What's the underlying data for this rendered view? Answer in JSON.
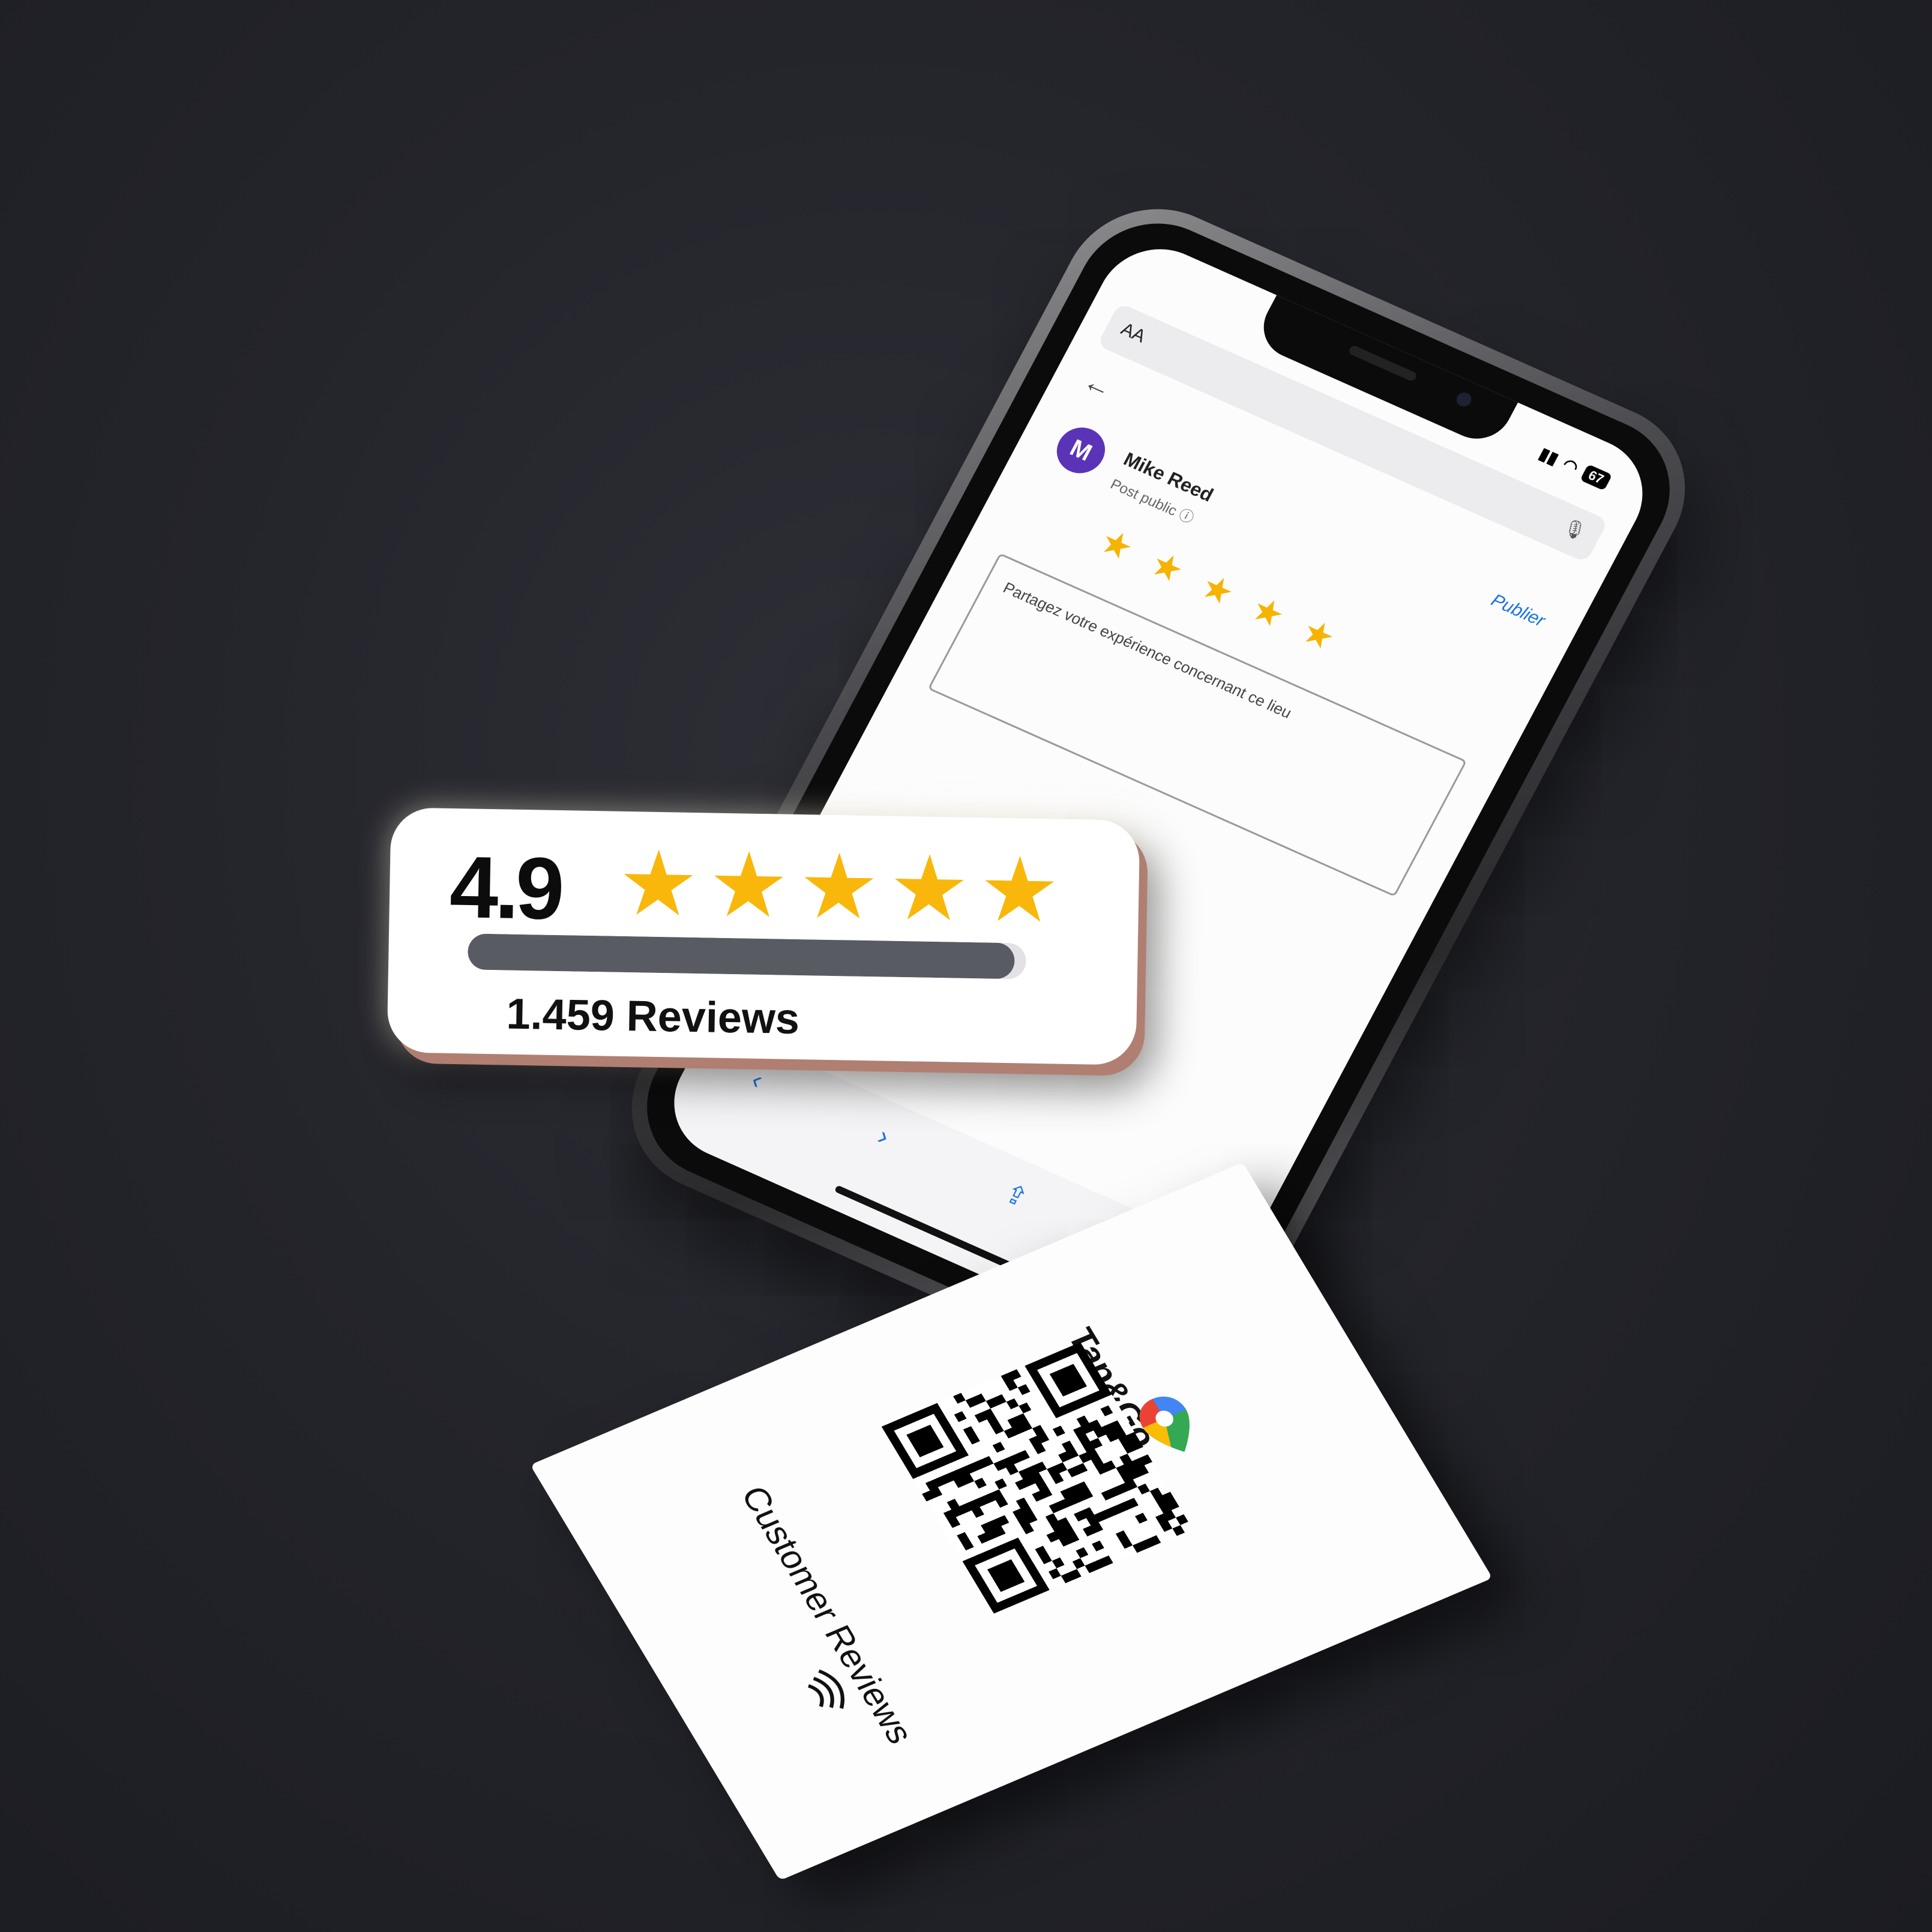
{
  "phone": {
    "url_bar": {
      "aa": "AA"
    },
    "status": {
      "battery": "67"
    },
    "review_form": {
      "publish_label": "Publier",
      "avatar_initial": "M",
      "reviewer_name": "Mike Reed",
      "visibility": "Post public",
      "star_rating": 5,
      "stars": [
        "★",
        "★",
        "★",
        "★",
        "★"
      ],
      "placeholder": "Partagez votre expérience concernant ce lieu"
    },
    "toolbar": {
      "back": "‹",
      "forward": "›",
      "share": "⇪",
      "bookmarks": "▢"
    }
  },
  "rating_card": {
    "rating": "4.9",
    "stars": [
      "★",
      "★",
      "★",
      "★",
      "★"
    ],
    "rating_fraction": 0.98,
    "reviews_label": "1.459 Reviews"
  },
  "nfc_card": {
    "brand": "Tap&Go",
    "label": "Customer Reviews",
    "icon": "google-maps-pin-icon",
    "nfc": "nfc-waves-icon"
  },
  "colors": {
    "star": "#f8b70a",
    "avatar": "#5b33b6",
    "link": "#1a73e8",
    "bar": "#595b62"
  }
}
